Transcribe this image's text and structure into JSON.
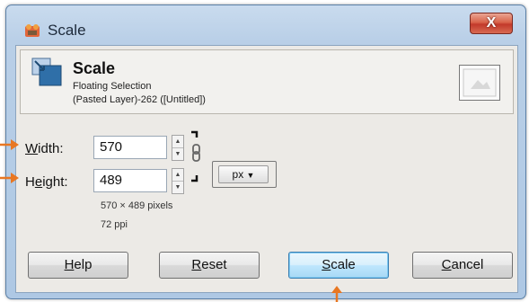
{
  "window": {
    "title": "Scale",
    "close_glyph": "X"
  },
  "header": {
    "title": "Scale",
    "subtitle": "Floating Selection",
    "layer_info": "(Pasted Layer)-262 ([Untitled])"
  },
  "width": {
    "label_underlined": "W",
    "label_rest": "idth:",
    "value": "570"
  },
  "height": {
    "label_start": "H",
    "label_underlined": "e",
    "label_rest": "ight:",
    "value": "489"
  },
  "unit": {
    "value": "px"
  },
  "info": {
    "pixels": "570 × 489 pixels",
    "resolution": "72 ppi"
  },
  "buttons": {
    "help": {
      "underlined": "H",
      "rest": "elp"
    },
    "reset": {
      "underlined": "R",
      "rest": "eset"
    },
    "scale": {
      "underlined": "S",
      "rest": "cale"
    },
    "cancel": {
      "underlined": "C",
      "rest": "ancel"
    }
  },
  "icons": {
    "app": "gimp-icon",
    "scale": "scale-tool-icon",
    "chain": "chain-link-icon",
    "preview": "layer-preview-icon"
  },
  "colors": {
    "arrow": "#e87722",
    "default_button": "#3c7fb1",
    "close_button": "#c2392a"
  }
}
